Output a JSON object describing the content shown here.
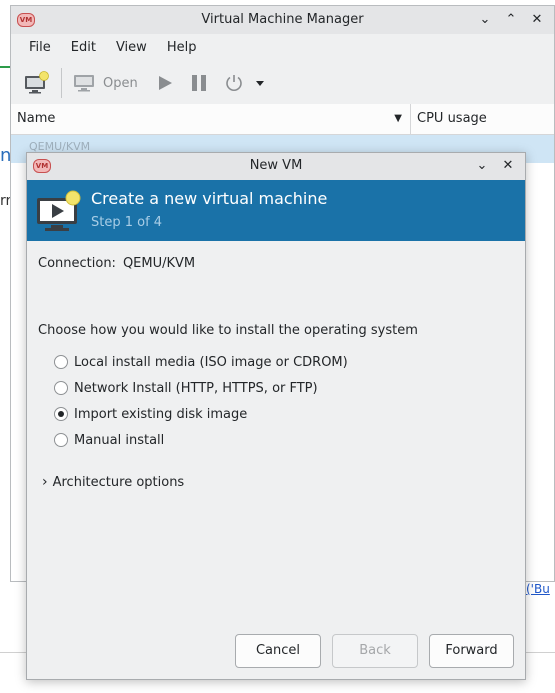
{
  "background": {
    "left_fragment_blue": "n",
    "left_fragment_text": "rr",
    "link_fragment": "('Bu"
  },
  "main_window": {
    "title": "Virtual Machine Manager",
    "app_logo": "VM",
    "menu": [
      "File",
      "Edit",
      "View",
      "Help"
    ],
    "toolbar": {
      "new_vm_icon": "new-vm-icon",
      "open_label": "Open",
      "run_icon": "play-icon",
      "pause_icon": "pause-icon",
      "shutdown_icon": "power-icon"
    },
    "table": {
      "columns": [
        "Name",
        "CPU usage"
      ],
      "selected_row": "QEMU/KVM"
    }
  },
  "dialog": {
    "title": "New VM",
    "app_logo": "VM",
    "header_title": "Create a new virtual machine",
    "header_step": "Step 1 of 4",
    "connection_label": "Connection:",
    "connection_value": "QEMU/KVM",
    "prompt": "Choose how you would like to install the operating system",
    "options": [
      {
        "label": "Local install media (ISO image or CDROM)",
        "selected": false
      },
      {
        "label": "Network Install (HTTP, HTTPS, or FTP)",
        "selected": false
      },
      {
        "label": "Import existing disk image",
        "selected": true
      },
      {
        "label": "Manual install",
        "selected": false
      }
    ],
    "architecture_label": "Architecture options",
    "buttons": {
      "cancel": "Cancel",
      "back": "Back",
      "forward": "Forward"
    }
  },
  "colors": {
    "banner": "#1a72a8",
    "selection": "#cfe5f5"
  }
}
